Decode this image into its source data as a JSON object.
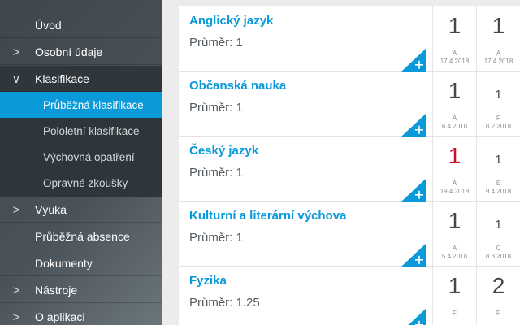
{
  "sidebar": {
    "items": [
      {
        "label": "Úvod",
        "chevron": ""
      },
      {
        "label": "Osobní údaje",
        "chevron": ">"
      },
      {
        "label": "Klasifikace",
        "chevron": "∨"
      },
      {
        "label": "Průběžná klasifikace",
        "chevron": ""
      },
      {
        "label": "Pololetní klasifikace",
        "chevron": ""
      },
      {
        "label": "Výchovná opatření",
        "chevron": ""
      },
      {
        "label": "Opravné zkoušky",
        "chevron": ""
      },
      {
        "label": "Výuka",
        "chevron": ">"
      },
      {
        "label": "Průběžná absence",
        "chevron": ""
      },
      {
        "label": "Dokumenty",
        "chevron": ""
      },
      {
        "label": "Nástroje",
        "chevron": ">"
      },
      {
        "label": "O aplikaci",
        "chevron": ">"
      }
    ]
  },
  "subjects": [
    {
      "name": "Anglický jazyk",
      "average": "Průměr: 1",
      "grades": [
        {
          "value": "1",
          "weight": "A",
          "date": "17.4.2018"
        },
        {
          "value": "1",
          "weight": "A",
          "date": "17.4.2018"
        }
      ]
    },
    {
      "name": "Občanská nauka",
      "average": "Průměr: 1",
      "grades": [
        {
          "value": "1",
          "weight": "A",
          "date": "6.4.2018"
        },
        {
          "value": "1",
          "weight": "F",
          "date": "8.2.2018"
        }
      ]
    },
    {
      "name": "Český jazyk",
      "average": "Průměr: 1",
      "grades": [
        {
          "value": "1",
          "weight": "A",
          "date": "19.4.2018"
        },
        {
          "value": "1",
          "weight": "E",
          "date": "9.4.2018"
        }
      ]
    },
    {
      "name": "Kulturní a literární výchova",
      "average": "Průměr: 1",
      "grades": [
        {
          "value": "1",
          "weight": "A",
          "date": "5.4.2018"
        },
        {
          "value": "1",
          "weight": "C",
          "date": "8.3.2018"
        }
      ]
    },
    {
      "name": "Fyzika",
      "average": "Průměr: 1.25",
      "grades": [
        {
          "value": "1",
          "weight": "F",
          "date": ""
        },
        {
          "value": "2",
          "weight": "F",
          "date": ""
        }
      ]
    }
  ],
  "colors": {
    "accent": "#0a9ad9",
    "grade_red": "#c8102e"
  },
  "icons": {
    "add": "plus-icon",
    "expand": "chevron-right-icon",
    "collapse": "chevron-down-icon"
  }
}
